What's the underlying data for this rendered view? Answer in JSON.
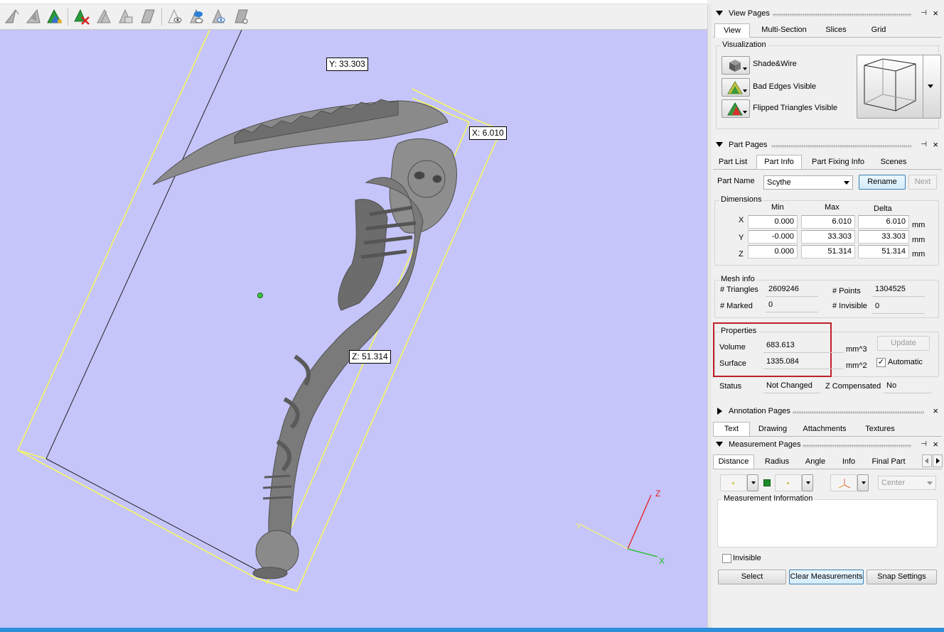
{
  "toolbar": {
    "icons": [
      "mark-triangle-icon",
      "mark-shell-icon",
      "mark-plane-icon",
      "unmark-icon",
      "invert-marking-icon",
      "shell-marking-icon",
      "mark-surface-icon",
      "visibility-toggle-icon",
      "shell-visibility-icon",
      "hide-icon",
      "section-icon"
    ]
  },
  "viewport": {
    "dim_y": "Y: 33.303",
    "dim_x": "X: 6.010",
    "dim_z": "Z: 51.314",
    "axis_x": "X",
    "axis_y": "Y",
    "axis_z": "Z",
    "colors": {
      "background": "#c5c5fa",
      "bounding_box": "#f5f542",
      "model": "#7a7a7a"
    }
  },
  "view_pages": {
    "title": "View Pages",
    "tabs": [
      "View",
      "Multi-Section",
      "Slices",
      "Grid"
    ],
    "active_tab": "View",
    "visualization": {
      "title": "Visualization",
      "items": [
        "Shade&Wire",
        "Bad Edges Visible",
        "Flipped Triangles Visible"
      ]
    }
  },
  "part_pages": {
    "title": "Part Pages",
    "tabs": [
      "Part List",
      "Part Info",
      "Part Fixing Info",
      "Scenes"
    ],
    "active_tab": "Part Info",
    "part_name_label": "Part Name",
    "part_name": "Scythe",
    "rename": "Rename",
    "next": "Next",
    "dimensions": {
      "title": "Dimensions",
      "headers": [
        "Min",
        "Max",
        "Delta"
      ],
      "unit": "mm",
      "rows": [
        {
          "axis": "X",
          "min": "0.000",
          "max": "6.010",
          "delta": "6.010"
        },
        {
          "axis": "Y",
          "min": "-0.000",
          "max": "33.303",
          "delta": "33.303"
        },
        {
          "axis": "Z",
          "min": "0.000",
          "max": "51.314",
          "delta": "51.314"
        }
      ]
    },
    "mesh_info": {
      "title": "Mesh info",
      "triangles_label": "# Triangles",
      "triangles": "2609246",
      "points_label": "# Points",
      "points": "1304525",
      "marked_label": "# Marked",
      "marked": "0",
      "invisible_label": "# Invisible",
      "invisible": "0"
    },
    "properties": {
      "title": "Properties",
      "volume_label": "Volume",
      "volume": "683.613",
      "volume_unit": "mm^3",
      "surface_label": "Surface",
      "surface": "1335.084",
      "surface_unit": "mm^2",
      "update": "Update",
      "automatic": "Automatic",
      "automatic_checked": "✓",
      "highlight_color": "#c0202a"
    },
    "status_label": "Status",
    "status": "Not Changed",
    "zcomp_label": "Z Compensated",
    "zcomp": "No"
  },
  "annotation_pages": {
    "title": "Annotation Pages",
    "tabs": [
      "Text",
      "Drawing",
      "Attachments",
      "Textures"
    ],
    "active_tab": "Text"
  },
  "measurement_pages": {
    "title": "Measurement Pages",
    "tabs": [
      "Distance",
      "Radius",
      "Angle",
      "Info",
      "Final Part"
    ],
    "active_tab": "Distance",
    "center": "Center",
    "info_title": "Measurement Information",
    "invisible": "Invisible",
    "select": "Select",
    "clear": "Clear Measurements",
    "snap": "Snap Settings"
  }
}
